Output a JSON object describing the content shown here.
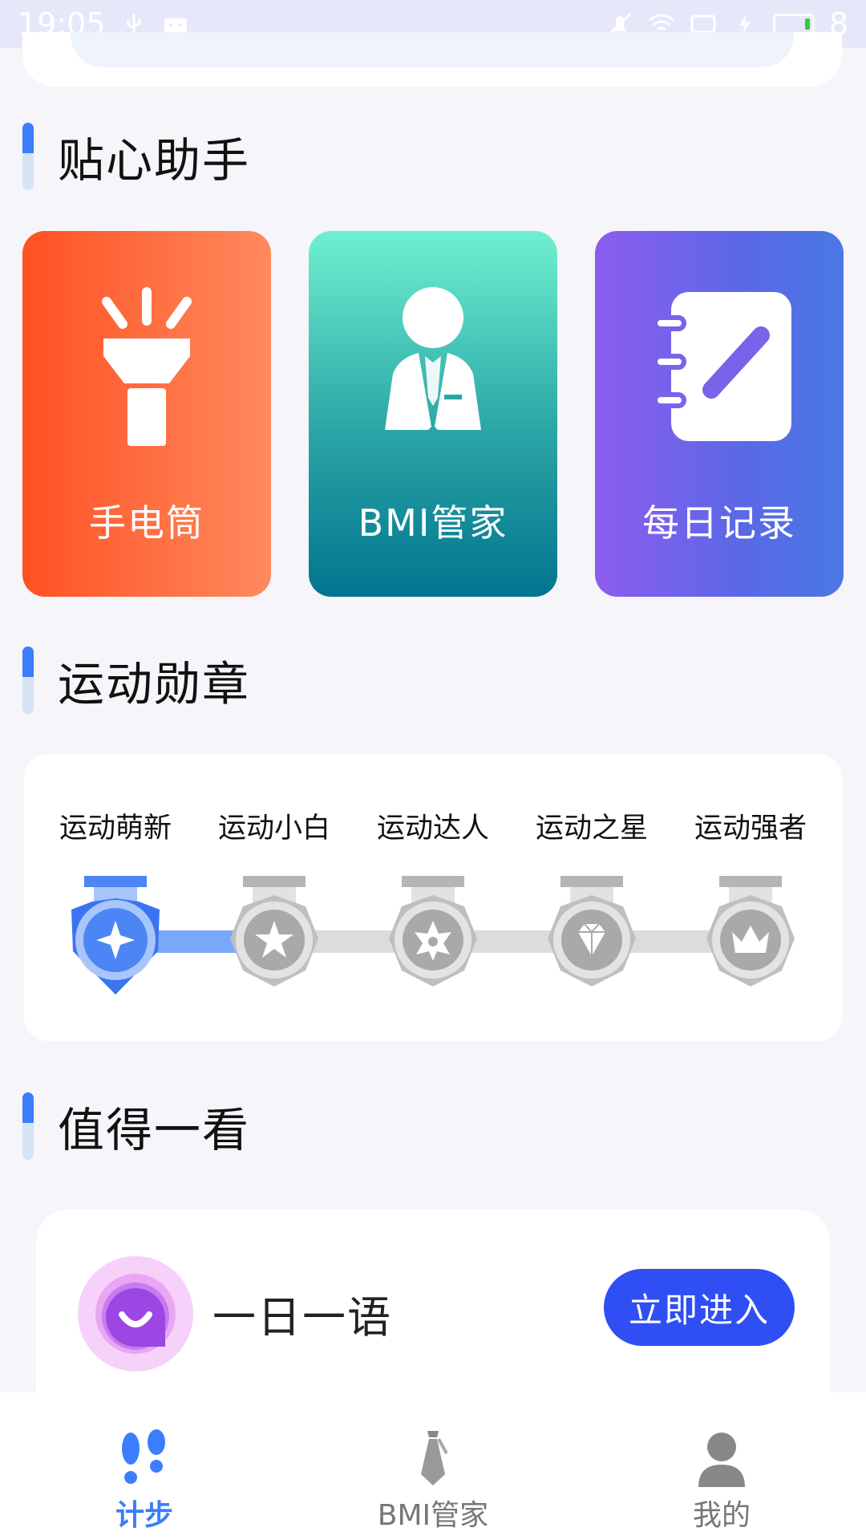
{
  "status_bar": {
    "time": "19:05",
    "battery_level": "8"
  },
  "sections": {
    "assistant_title": "贴心助手",
    "medals_title": "运动勋章",
    "worth_title": "值得一看"
  },
  "tools": [
    {
      "label": "手电筒",
      "icon": "flashlight-icon"
    },
    {
      "label": "BMI管家",
      "icon": "bmi-person-icon"
    },
    {
      "label": "每日记录",
      "icon": "notebook-icon"
    }
  ],
  "medals": {
    "items": [
      {
        "label": "运动萌新",
        "state": "achieved",
        "icon": "star4-medal-icon"
      },
      {
        "label": "运动小白",
        "state": "locked",
        "icon": "star5-medal-icon"
      },
      {
        "label": "运动达人",
        "state": "locked",
        "icon": "flower-medal-icon"
      },
      {
        "label": "运动之星",
        "state": "locked",
        "icon": "diamond-medal-icon"
      },
      {
        "label": "运动强者",
        "state": "locked",
        "icon": "crown-medal-icon"
      }
    ],
    "colors": {
      "achieved": "#5b8ef7",
      "locked": "#c8c8c8"
    }
  },
  "recommend": {
    "title": "一日一语",
    "button": "立即进入",
    "icon": "chat-bubble-icon"
  },
  "bottom_nav": [
    {
      "label": "计步",
      "icon": "footsteps-icon",
      "active": true
    },
    {
      "label": "BMI管家",
      "icon": "tie-icon",
      "active": false
    },
    {
      "label": "我的",
      "icon": "person-icon",
      "active": false
    }
  ],
  "colors": {
    "accent": "#3b7dfc",
    "button": "#2f4ff5"
  }
}
